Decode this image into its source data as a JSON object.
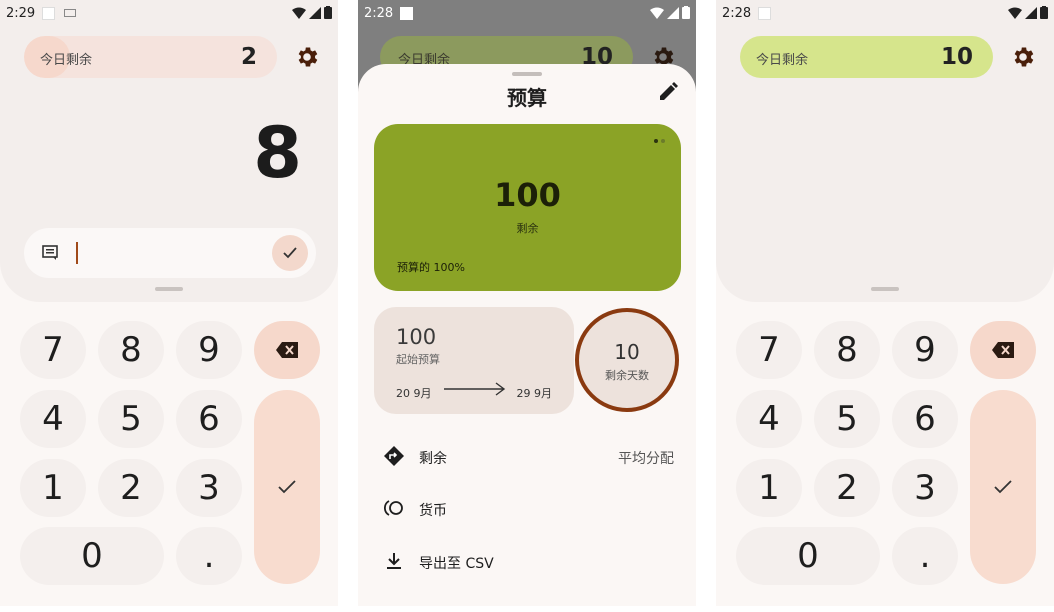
{
  "screen1": {
    "status_time": "2:29",
    "remaining_label": "今日剩余",
    "remaining_value": "2",
    "remaining_fraction": 0.18,
    "entry_value": "8",
    "keys": [
      "7",
      "8",
      "9",
      "4",
      "5",
      "6",
      "1",
      "2",
      "3",
      "0",
      "."
    ]
  },
  "screen2": {
    "status_time": "2:28",
    "remaining_label": "今日剩余",
    "remaining_value": "10",
    "sheet_title": "预算",
    "card_value": "100",
    "card_label": "剩余",
    "card_percent": "预算的 100%",
    "start_budget_value": "100",
    "start_budget_label": "起始预算",
    "date_start": "20 9月",
    "date_end": "29 9月",
    "days_left_value": "10",
    "days_left_label": "剩余天数",
    "rows": [
      {
        "label": "剩余",
        "value": "平均分配",
        "icon": "directions-icon"
      },
      {
        "label": "货币",
        "value": "",
        "icon": "currency-icon"
      },
      {
        "label": "导出至 CSV",
        "value": "",
        "icon": "download-icon"
      }
    ]
  },
  "screen3": {
    "status_time": "2:28",
    "remaining_label": "今日剩余",
    "remaining_value": "10",
    "keys": [
      "7",
      "8",
      "9",
      "4",
      "5",
      "6",
      "1",
      "2",
      "3",
      "0",
      "."
    ]
  },
  "colors": {
    "accent_orange": "#f6d8cb",
    "green_card": "#8ba326",
    "green_pill": "#d6e58c",
    "ring_brown": "#8a3a10"
  }
}
